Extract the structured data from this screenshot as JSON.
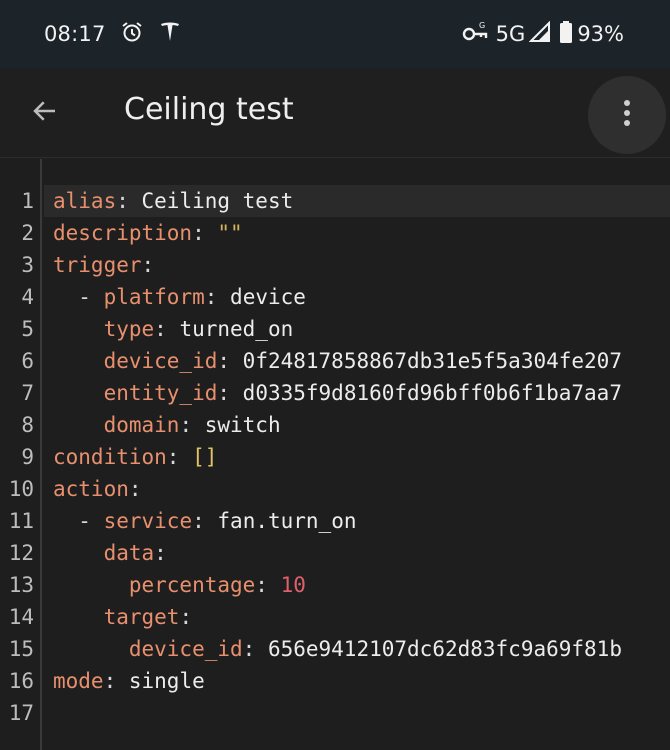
{
  "status_bar": {
    "time": "08:17",
    "network": "5G",
    "battery": "93%",
    "icons": [
      "alarm-icon",
      "tesla-icon",
      "vpn-key-icon",
      "signal-icon",
      "battery-icon"
    ]
  },
  "toolbar": {
    "title": "Ceiling test",
    "back_icon": "arrow-left-icon",
    "menu_icon": "more-vertical-icon"
  },
  "editor": {
    "line_numbers": [
      "1",
      "2",
      "3",
      "4",
      "5",
      "6",
      "7",
      "8",
      "9",
      "10",
      "11",
      "12",
      "13",
      "14",
      "15",
      "16",
      "17"
    ],
    "lines": [
      {
        "indent": "",
        "key": "alias",
        "value": "Ceiling test"
      },
      {
        "indent": "",
        "key": "description",
        "value": "\"\""
      },
      {
        "indent": "",
        "key": "trigger",
        "value": ""
      },
      {
        "indent": "  ",
        "dash": "- ",
        "key": "platform",
        "value": "device"
      },
      {
        "indent": "    ",
        "key": "type",
        "value": "turned_on"
      },
      {
        "indent": "    ",
        "key": "device_id",
        "value": "0f24817858867db31e5f5a304fe207"
      },
      {
        "indent": "    ",
        "key": "entity_id",
        "value": "d0335f9d8160fd96bff0b6f1ba7aa7"
      },
      {
        "indent": "    ",
        "key": "domain",
        "value": "switch"
      },
      {
        "indent": "",
        "key": "condition",
        "value": "[]"
      },
      {
        "indent": "",
        "key": "action",
        "value": ""
      },
      {
        "indent": "  ",
        "dash": "- ",
        "key": "service",
        "value": "fan.turn_on"
      },
      {
        "indent": "    ",
        "key": "data",
        "value": ""
      },
      {
        "indent": "      ",
        "key": "percentage",
        "value": "10"
      },
      {
        "indent": "    ",
        "key": "target",
        "value": ""
      },
      {
        "indent": "      ",
        "key": "device_id",
        "value": "656e9412107dc62d83fc9a69f81b"
      },
      {
        "indent": "",
        "key": "mode",
        "value": "single"
      },
      {
        "indent": "",
        "key": "",
        "value": ""
      }
    ],
    "colors": {
      "key": "#e8906e",
      "string": "#d6b45a",
      "number": "#e0606a",
      "text": "#ececec"
    }
  }
}
